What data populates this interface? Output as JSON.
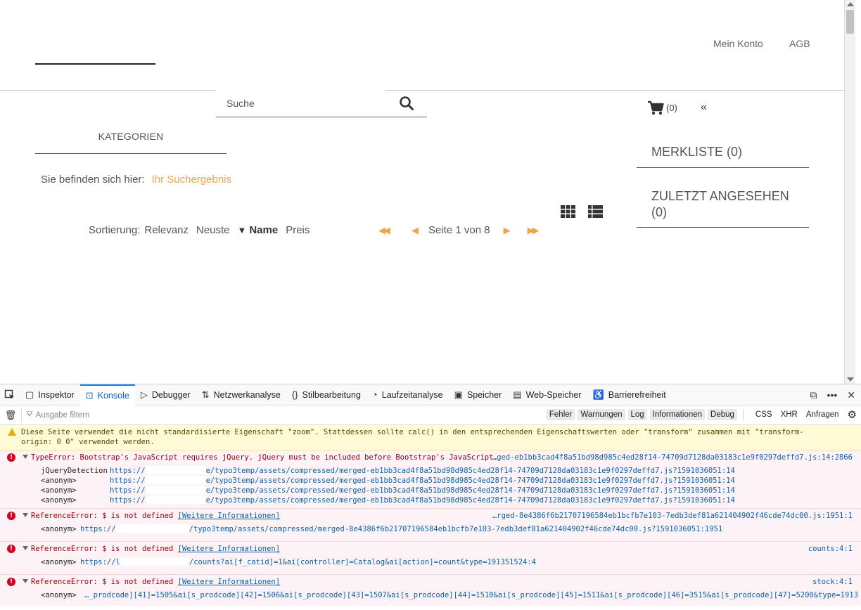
{
  "site": {
    "nav": {
      "account": "Mein Konto",
      "terms": "AGB"
    },
    "search": {
      "placeholder": "Suche"
    },
    "cart": {
      "count": "(0)",
      "collapse": "«"
    },
    "categories_heading": "KATEGORIEN",
    "sidebar": {
      "wishlist": "MERKLISTE (0)",
      "recent_line1": "ZULETZT ANGESEHEN",
      "recent_line2": "(0)"
    },
    "breadcrumb": {
      "label": "Sie befinden sich hier:",
      "current": "Ihr Suchergebnis"
    },
    "sort": {
      "label": "Sortierung:",
      "options": [
        "Relevanz",
        "Neuste",
        "Name",
        "Preis"
      ],
      "active_marker": "▼"
    },
    "pager": {
      "first": "◀◀",
      "prev": "◀",
      "text": "Seite 1 von 8",
      "next": "▶",
      "last": "▶▶"
    }
  },
  "devtools": {
    "tabs": [
      "Inspektor",
      "Konsole",
      "Debugger",
      "Netzwerkanalyse",
      "Stilbearbeitung",
      "Laufzeitanalyse",
      "Speicher",
      "Web-Speicher",
      "Barrierefreiheit"
    ],
    "filter_placeholder": "Ausgabe filtern",
    "levels": [
      "Fehler",
      "Warnungen",
      "Log",
      "Informationen",
      "Debug"
    ],
    "types": [
      "CSS",
      "XHR",
      "Anfragen"
    ],
    "warning": {
      "line1": "Diese Seite verwendet die nicht standardisierte Eigenschaft \"zoom\". Stattdessen sollte calc() in den entsprechenden Eigenschaftswerten oder \"transform\" zusammen mit \"transform-",
      "line2": "origin: 0 0\" verwendet werden."
    },
    "errors": [
      {
        "text": "TypeError: Bootstrap's JavaScript requires jQuery. jQuery must be included before Bootstrap's JavaScript.",
        "source": "…ged-eb1bb3cad4f8a51bd98d985c4ed28f14-74709d7128da03183c1e9f0297deffd7.js:14:2866",
        "stack": [
          {
            "fn": "jQueryDetection",
            "url": "https://",
            "path": "e/typo3temp/assets/compressed/merged-eb1bb3cad4f8a51bd98d985c4ed28f14-74709d7128da03183c1e9f0297deffd7.js?1591036051:14"
          },
          {
            "fn": "<anonym>",
            "url": "https://",
            "path": "e/typo3temp/assets/compressed/merged-eb1bb3cad4f8a51bd98d985c4ed28f14-74709d7128da03183c1e9f0297deffd7.js?1591036051:14"
          },
          {
            "fn": "<anonym>",
            "url": "https://",
            "path": "e/typo3temp/assets/compressed/merged-eb1bb3cad4f8a51bd98d985c4ed28f14-74709d7128da03183c1e9f0297deffd7.js?1591036051:14"
          },
          {
            "fn": "<anonym>",
            "url": "https://",
            "path": "e/typo3temp/assets/compressed/merged-eb1bb3cad4f8a51bd98d985c4ed28f14-74709d7128da03183c1e9f0297deffd7.js?1591036051:14"
          }
        ]
      },
      {
        "text": "ReferenceError: $ is not defined",
        "more": "[Weitere Informationen]",
        "source": "…rged-8e4386f6b21707196584eb1bcfb7e103-7edb3def81a621404902f46cde74dc00.js:1951:1",
        "stack_fn": "<anonym>",
        "stack_url": "https://",
        "stack_path": "/typo3temp/assets/compressed/merged-8e4386f6b21707196584eb1bcfb7e103-7edb3def81a621404902f46cde74dc00.js?1591036051:1951"
      },
      {
        "text": "ReferenceError: $ is not defined",
        "more": "[Weitere Informationen]",
        "source": "counts:4:1",
        "stack_fn": "<anonym>",
        "stack_url": "https://l",
        "stack_path": "/counts?ai[f_catid]=1&ai[controller]=Catalog&ai[action]=count&type=191351524:4"
      },
      {
        "text": "ReferenceError: $ is not defined",
        "more": "[Weitere Informationen]",
        "source": "stock:4:1",
        "stack_fn": "<anonym>",
        "stack_path": "…_prodcode][41]=1505&ai[s_prodcode][42]=1506&ai[s_prodcode][43]=1507&ai[s_prodcode][44]=1510&ai[s_prodcode][45]=1511&ai[s_prodcode][46]=3515&ai[s_prodcode][47]=5200&type=191351524:4"
      }
    ]
  }
}
